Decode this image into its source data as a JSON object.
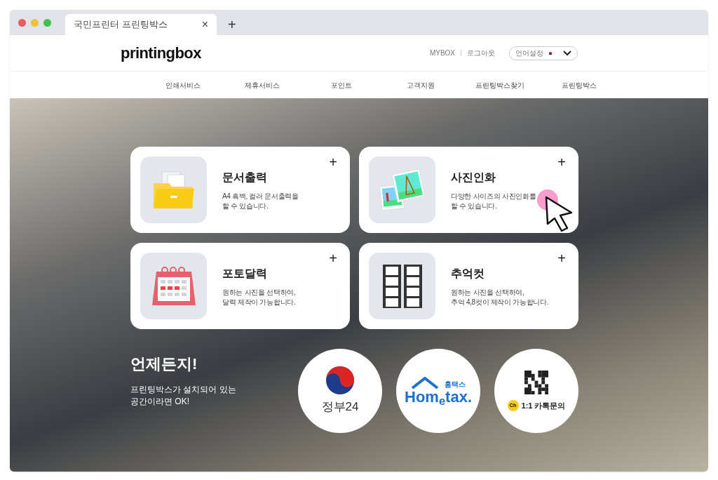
{
  "browser": {
    "tab_title": "국민프린터 프린팅박스",
    "close": "×",
    "new_tab": "+"
  },
  "header": {
    "logo": "printingbox",
    "links": [
      "MYBOX",
      "로그아웃"
    ],
    "language": {
      "label": "언어설정"
    }
  },
  "nav": [
    "인쇄서비스",
    "제휴서비스",
    "포인트",
    "고객지원",
    "프린팅박스찾기",
    "프린팅박스"
  ],
  "services": [
    {
      "kind": "document",
      "title": "문서출력",
      "description": "A4 흑백, 컬러 문서출력을\n할 수 있습니다.",
      "plus": "+",
      "pointer": false
    },
    {
      "kind": "photo",
      "title": "사진인화",
      "description": "다양한 사이즈의 사진인화를\n할 수 있습니다.",
      "plus": "+",
      "pointer": true
    },
    {
      "kind": "calendar",
      "title": "포토달력",
      "description": "원하는 사진을 선택하여,\n달력 제작이 가능합니다.",
      "plus": "+",
      "pointer": false
    },
    {
      "kind": "film",
      "title": "추억컷",
      "description": "원하는 사진을 선택하여,\n추억 4,8컷이 제작이 가능합니다.",
      "plus": "+",
      "pointer": false
    }
  ],
  "promo": {
    "headline": "언제든지!",
    "text": "프린팅박스가 설치되어 있는\n공간이라면 OK!"
  },
  "shortcuts": [
    {
      "kind": "gov24",
      "label": "정부24"
    },
    {
      "kind": "hometax",
      "label": "Hom$_{e}$tax.",
      "sublabel": "홈택스"
    },
    {
      "kind": "kakao",
      "label": "1:1 카톡문의",
      "badge": "Ch"
    }
  ]
}
